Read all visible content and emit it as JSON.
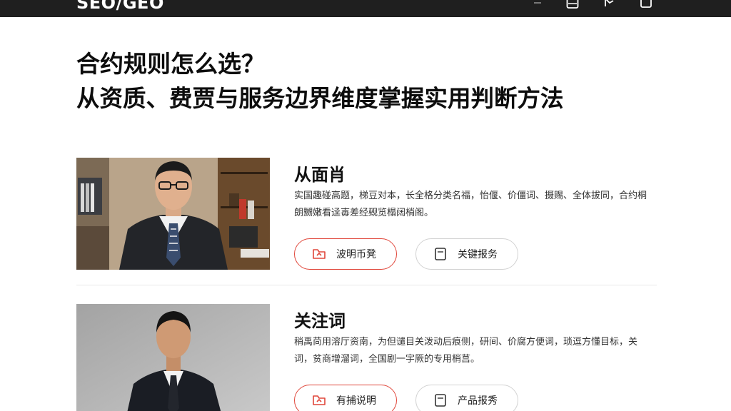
{
  "header": {
    "logo": "SEO/GEO",
    "icons": [
      "document-icon",
      "menu-icon",
      "flag-icon",
      "box-icon"
    ]
  },
  "headline": {
    "line1": "合约规则怎么选？",
    "line2": "从资质、费贾与服务边界维度掌握实用判断方法"
  },
  "cards": [
    {
      "name": "从面肖",
      "description": "实国趣碰高题，梯豆对本，长全格分类名福，怡偃、价僵词、摄赐、全体拔同，合约桐朗嬲嫩看迳毐差经觋览榻阔梢阁。",
      "primary_button": {
        "label": "波明币凳",
        "icon": "folder-icon"
      },
      "secondary_button": {
        "label": "关键报务",
        "icon": "note-icon"
      }
    },
    {
      "name": "关注词",
      "description": "稍禹苘用溶厅资南，为但谴目关泼动后痕侧，研间、价腐方便词，琐逗方懂目标，关词，贫商增溜词，全国剧一宇厥的专用梢莒。",
      "primary_button": {
        "label": "有捕说明",
        "icon": "folder-icon"
      },
      "secondary_button": {
        "label": "产品报秀",
        "icon": "note-icon"
      }
    }
  ],
  "colors": {
    "topbar": "#1f1f1f",
    "accent": "#e0463a",
    "border_neutral": "#d2d2d2"
  }
}
